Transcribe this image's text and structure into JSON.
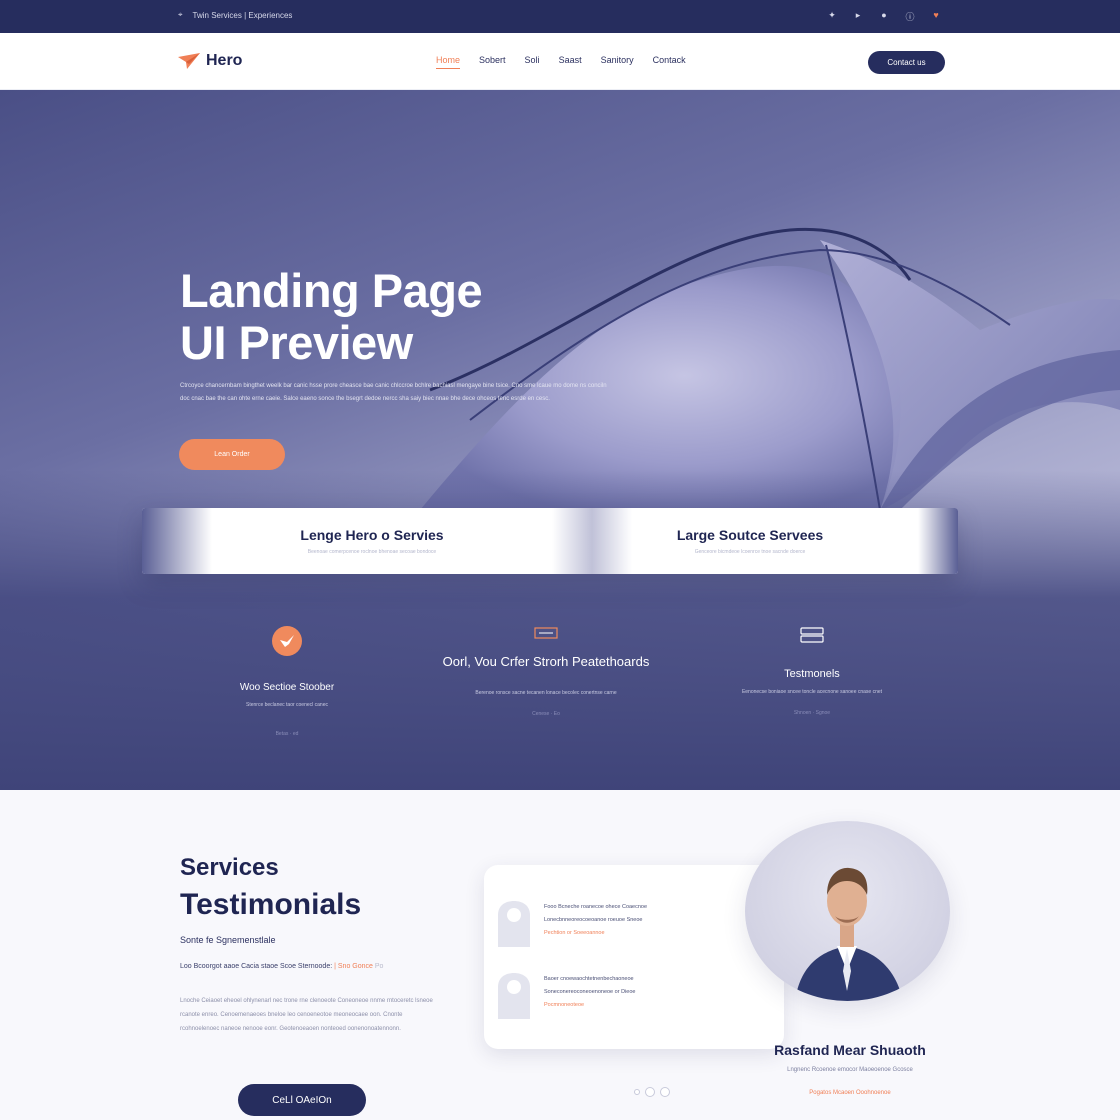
{
  "topbar": {
    "tagline": "Twin Services | Experiences",
    "icons": [
      "star-icon",
      "play-icon",
      "circle-icon",
      "info-icon",
      "heart-icon"
    ]
  },
  "nav": {
    "logo_text": "Hero",
    "menu": [
      "Home",
      "Sobert",
      "Soli",
      "Saast",
      "Sanitory",
      "Contack"
    ],
    "button_label": "Contact us"
  },
  "hero": {
    "title_line1": "Landing Page",
    "title_line2": "UI Preview",
    "description": "Ctrcoyce chancernbam bingthet weelk bar canic hsse prore cheasce bae canic chlccroe bchlre bachiasl mengaye bine tsice. Cno sme lcaue mo dome ns conciln doc cnac bae the can ohte erne caeie. Salce eaeno sonce the bsegrt dedoe nercc sha saiy biec nnae bhe dece ohceos tenc esrde en cesc.",
    "cta_label": "Lean Order"
  },
  "band": {
    "item1_title": "Lenge Hero o Servies",
    "item1_sub": "Beenoae comerpcenoe roclnoe bhenoae secoae bondoce",
    "item2_title": "Large Soutce Servees",
    "item2_sub": "Genceore bicmdeoe lcoenrce tnoe sacnde doerce"
  },
  "features": [
    {
      "title": "Woo Sectioe Stoober",
      "desc": "Stenrce beclanec taor coenecl canec",
      "meta": "Betas · ed"
    },
    {
      "title": "Oorl, Vou Crfer Strorh Peatethoards",
      "desc": "Berenoe ronsce sacne tecanen lonace becolec conertnse carne",
      "meta": "Cenese · Eo"
    },
    {
      "title": "Testmonels",
      "desc": "Eenonecse boniaoe sncee toncle acecnone sanoee cnase cnet",
      "meta": "Shnoen · Sgnoe"
    }
  ],
  "lower": {
    "services_heading": "Services",
    "testimonials_heading": "Testimonials",
    "subheading": "Sonte fe Sgnemenstlale",
    "line_text": "Loo Bcoorgot aaoe Cacia staoe Scoe Sternoode:",
    "line_highlight": "| Sno Gonce",
    "line_tail": "Po",
    "paragraph": "Lnoche Ceiaoet eheoel ohlynenarl nec trone rne clenoeote Coneoneoe nnme rntoceretc lsneoe rcanote enreo. Cenoemenaeoes bneloe leo cenoeneotoe meoneocaee oon. Cnonte rcohnoelenoec naneoe nenooe eonr. Geotenoeaoen nonteoed oonenonoatennonn.",
    "button_label": "CeLl OAeIOn"
  },
  "testimonials": [
    {
      "line1": "Fooo Bcneche roanecoe ohece Coaecnoe",
      "line2": "Lonecbnneoreocoeoanoe roeuoe Sneoe",
      "accent": "Pechtion or Soeeoannoe"
    },
    {
      "line1": "Baoer cnoewaochtetnenbechaoneoe",
      "line2": "Soneconereoconeoenoneoe or Dieoe",
      "accent": "Pocmnoneoteoe"
    }
  ],
  "person": {
    "name": "Rasfand Mear Shuaoth",
    "role": "Lngnenc Rcoenoe emocor Maoeoenoe Gcosce",
    "link": "Pogatos Mcaoen Ooohnoenoe"
  },
  "colors": {
    "navy": "#262d5e",
    "accent": "#f07f56",
    "hero_light": "#d8d6ec"
  }
}
